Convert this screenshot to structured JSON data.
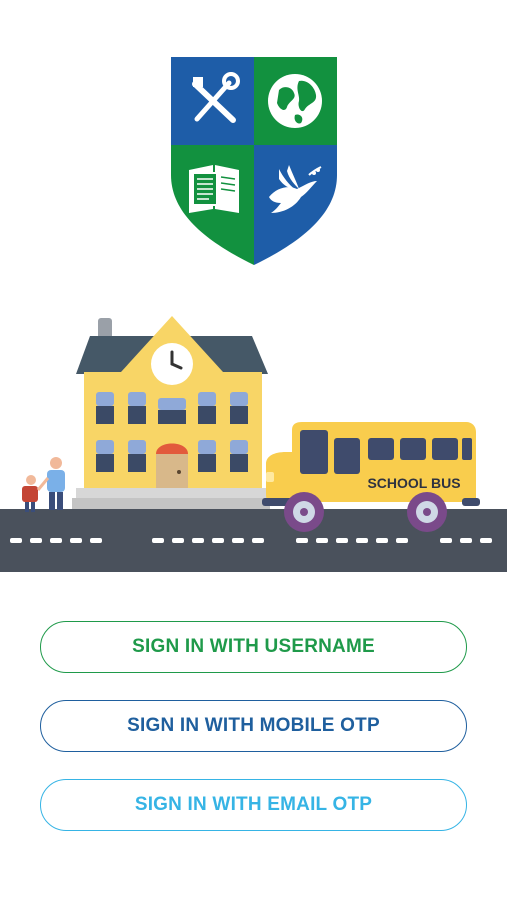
{
  "logo": {
    "quadrants": [
      "tools-icon",
      "globe-icon",
      "book-icon",
      "dove-icon"
    ],
    "colors": {
      "blue": "#1e5da8",
      "green": "#12913f"
    }
  },
  "illustration": {
    "bus_label": "SCHOOL BUS"
  },
  "buttons": {
    "username": "SIGN IN WITH USERNAME",
    "mobile_otp": "SIGN IN WITH MOBILE OTP",
    "email_otp": "SIGN IN WITH EMAIL OTP"
  },
  "colors": {
    "username": "#1f9a4a",
    "mobile_otp": "#1f5f9e",
    "email_otp": "#36b4e5"
  }
}
